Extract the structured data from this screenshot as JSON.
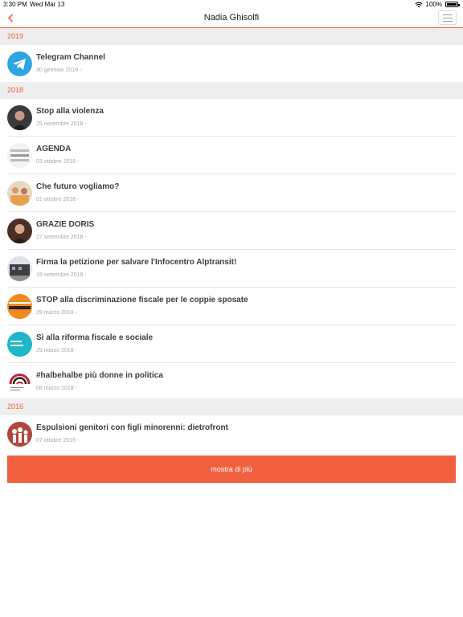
{
  "status_bar": {
    "time": "3:30 PM",
    "date": "Wed Mar 13",
    "battery": "100%"
  },
  "header": {
    "title": "Nadia Ghisolfi"
  },
  "sections": [
    {
      "year": "2019",
      "items": [
        {
          "title": "Telegram Channel",
          "date": "30 gennaio 2019 -",
          "thumb": "telegram-logo"
        }
      ]
    },
    {
      "year": "2018",
      "items": [
        {
          "title": "Stop alla violenza",
          "date": "25 novembre 2018 -",
          "thumb": "woman-portrait"
        },
        {
          "title": "AGENDA",
          "date": "03 ottobre 2018 -",
          "thumb": "calendar-image"
        },
        {
          "title": "Che futuro vogliamo?",
          "date": "01 ottobre 2018 -",
          "thumb": "people-image"
        },
        {
          "title": "GRAZIE DORIS",
          "date": "27 settembre 2018 -",
          "thumb": "woman-portrait"
        },
        {
          "title": "Firma la petizione per salvare l'Infocentro Alptransit!",
          "date": "19 settembre 2018 -",
          "thumb": "building-image"
        },
        {
          "title": "STOP alla discriminazione fiscale per le coppie sposate",
          "date": "29 marzo 2018 -",
          "thumb": "campaign-badge"
        },
        {
          "title": "Sì alla riforma fiscale e sociale",
          "date": "29 marzo 2018 -",
          "thumb": "campaign-badge"
        },
        {
          "title": "#halbehalbe più donne in politica",
          "date": "08 marzo 2018 -",
          "thumb": "campaign-logo"
        }
      ]
    },
    {
      "year": "2016",
      "items": [
        {
          "title": "Espulsioni genitori con figli minorenni: dietrofront",
          "date": "07 ottobre 2016 -",
          "thumb": "family-image"
        }
      ]
    }
  ],
  "more_button": {
    "label": "mostra di più"
  },
  "colors": {
    "accent": "#f2603f",
    "section_bg": "#eeeeee",
    "telegram": "#2ca5e0"
  }
}
